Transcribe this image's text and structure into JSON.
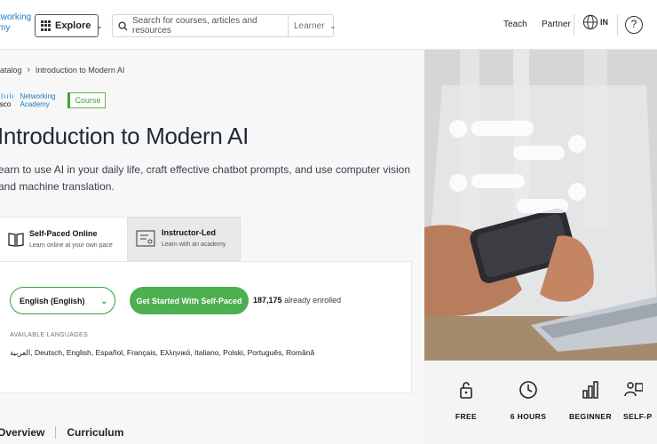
{
  "header": {
    "logo_line1": "tworking",
    "logo_line2": "my",
    "explore_label": "Explore",
    "search_placeholder": "Search for courses, articles and resources",
    "learner_select": "Learner",
    "teach_link": "Teach",
    "partner_link": "Partner",
    "region_label": "IN",
    "help_label": "?"
  },
  "breadcrumb": {
    "parent": "atalog",
    "current": "Introduction to Modern AI"
  },
  "provider": {
    "cisco": "isco",
    "academy_line1": "Networking",
    "academy_line2": "Academy",
    "tag": "Course"
  },
  "course": {
    "title": "Introduction to Modern AI",
    "description": "earn to use AI in your daily life, craft effective chatbot prompts, and use computer vision and machine translation."
  },
  "tabs": [
    {
      "title": "Self-Paced Online",
      "subtitle": "Learn online at your own pace"
    },
    {
      "title": "Instructor-Led",
      "subtitle": "Learn with an academy"
    }
  ],
  "enroll": {
    "language_selected": "English (English)",
    "start_button": "Get Started With Self-Paced",
    "enrolled_count": "187,175",
    "enrolled_suffix": "already enrolled",
    "available_label": "AVAILABLE LANGUAGES",
    "languages": "العربية, Deutsch, English, Español, Français, Ελληνικά, Italiano, Polski, Português, Română"
  },
  "section_tabs": {
    "overview": "Overview",
    "curriculum": "Curriculum"
  },
  "stats": [
    {
      "icon": "lock-icon",
      "label": "FREE"
    },
    {
      "icon": "clock-icon",
      "label": "6 HOURS"
    },
    {
      "icon": "bar-chart-icon",
      "label": "BEGINNER"
    },
    {
      "icon": "self-paced-icon",
      "label": "SELF-P"
    }
  ]
}
